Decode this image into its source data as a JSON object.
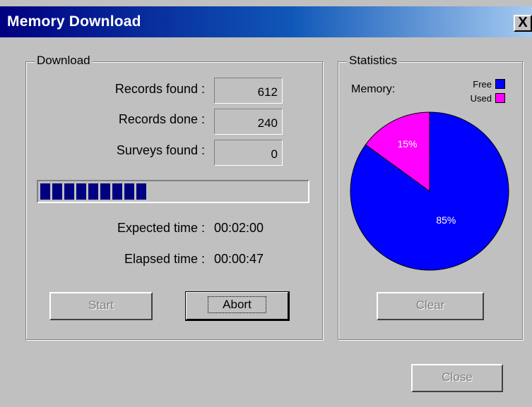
{
  "window": {
    "title": "Memory Download",
    "close_glyph": "X",
    "close_icon": "close-icon"
  },
  "download": {
    "group_label": "Download",
    "records_found_label": "Records found :",
    "records_found_value": "612",
    "records_done_label": "Records done :",
    "records_done_value": "240",
    "surveys_found_label": "Surveys found :",
    "surveys_found_value": "0",
    "progress_fraction": 0.39,
    "expected_time_label": "Expected time :",
    "expected_time_value": "00:02:00",
    "elapsed_time_label": "Elapsed time :",
    "elapsed_time_value": "00:00:47",
    "start_button": "Start",
    "abort_button": "Abort"
  },
  "statistics": {
    "group_label": "Statistics",
    "memory_label": "Memory:",
    "legend": [
      {
        "label": "Free",
        "color": "#0000ff"
      },
      {
        "label": "Used",
        "color": "#ff00ff"
      }
    ],
    "clear_button": "Clear"
  },
  "chart_data": {
    "type": "pie",
    "categories": [
      "Free",
      "Used"
    ],
    "values": [
      85,
      15
    ],
    "colors": [
      "#0000ff",
      "#ff00ff"
    ],
    "slice_labels": [
      "85%",
      "15%"
    ],
    "title": "",
    "legend_position": "top-right"
  },
  "footer": {
    "close_button": "Close"
  },
  "colors": {
    "titlebar_start": "#000080",
    "titlebar_end": "#a6caf0",
    "face": "#c0c0c0",
    "progress_fill": "#000080"
  }
}
